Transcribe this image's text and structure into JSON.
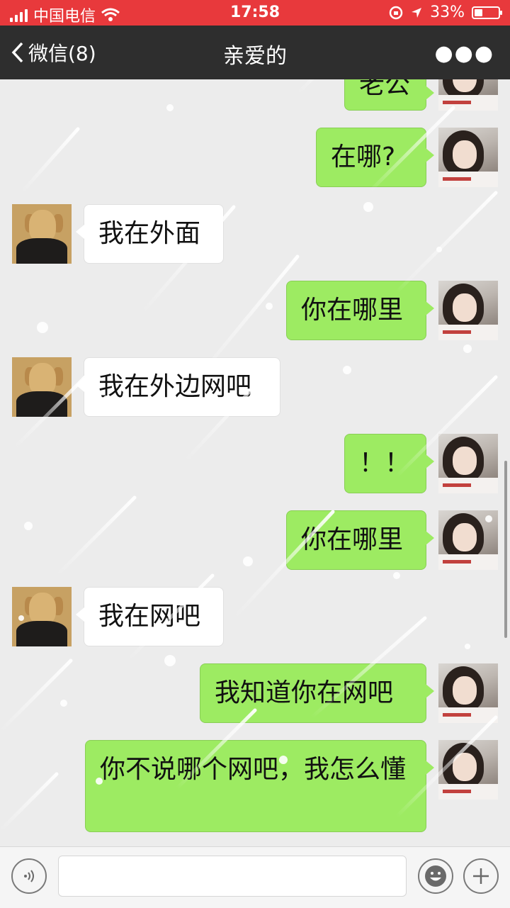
{
  "status_bar": {
    "carrier": "中国电信",
    "time": "17:58",
    "battery_percent": "33%",
    "battery_level": 0.33
  },
  "nav": {
    "back_label": "微信(8)",
    "title": "亲爱的"
  },
  "messages": [
    {
      "side": "right",
      "text": "老公"
    },
    {
      "side": "right",
      "text": "在哪?"
    },
    {
      "side": "left",
      "text": "我在外面"
    },
    {
      "side": "right",
      "text": "你在哪里"
    },
    {
      "side": "left",
      "text": "我在外边网吧"
    },
    {
      "side": "right",
      "text": "！！"
    },
    {
      "side": "right",
      "text": "你在哪里"
    },
    {
      "side": "left",
      "text": "我在网吧"
    },
    {
      "side": "right",
      "text": "我知道你在网吧"
    },
    {
      "side": "right",
      "text": "你不说哪个网吧，我怎么懂"
    }
  ],
  "input_bar": {
    "voice_icon": "voice-icon",
    "emoji_icon": "emoji-icon",
    "plus_icon": "plus-icon",
    "text_value": ""
  },
  "colors": {
    "status_bar": "#e8393c",
    "nav_bar": "#2e2e2e",
    "bubble_sent": "#9deb62",
    "bubble_received": "#ffffff",
    "chat_background": "#ececec"
  }
}
